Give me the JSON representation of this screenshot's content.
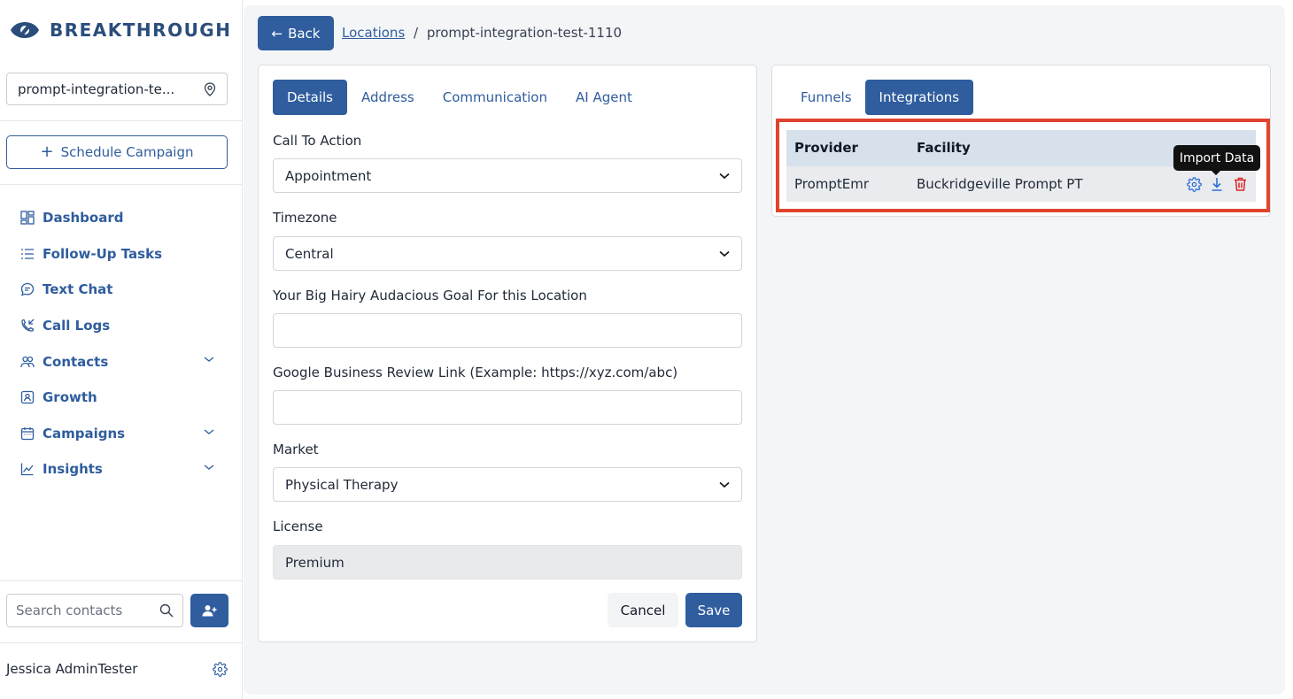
{
  "brand": {
    "name": "BREAKTHROUGH"
  },
  "sidebar": {
    "location_select": "prompt-integration-te...",
    "schedule_button": "Schedule Campaign",
    "nav": [
      {
        "label": "Dashboard",
        "icon": "dashboard-icon"
      },
      {
        "label": "Follow-Up Tasks",
        "icon": "list-icon"
      },
      {
        "label": "Text Chat",
        "icon": "chat-icon"
      },
      {
        "label": "Call Logs",
        "icon": "phone-icon"
      },
      {
        "label": "Contacts",
        "icon": "contacts-icon",
        "expandable": true
      },
      {
        "label": "Growth",
        "icon": "growth-icon"
      },
      {
        "label": "Campaigns",
        "icon": "calendar-icon",
        "expandable": true
      },
      {
        "label": "Insights",
        "icon": "chart-line-icon",
        "expandable": true
      }
    ],
    "search_placeholder": "Search contacts",
    "user_name": "Jessica AdminTester"
  },
  "header": {
    "back_label": "Back",
    "breadcrumb_link": "Locations",
    "breadcrumb_separator": "/",
    "breadcrumb_current": "prompt-integration-test-1110"
  },
  "left_card": {
    "tabs": [
      "Details",
      "Address",
      "Communication",
      "AI Agent"
    ],
    "active_tab": "Details",
    "fields": {
      "cta_label": "Call To Action",
      "cta_value": "Appointment",
      "timezone_label": "Timezone",
      "timezone_value": "Central",
      "goal_label": "Your Big Hairy Audacious Goal For this Location",
      "goal_value": "",
      "review_label": "Google Business Review Link (Example: https://xyz.com/abc)",
      "review_value": "",
      "market_label": "Market",
      "market_value": "Physical Therapy",
      "license_label": "License",
      "license_value": "Premium"
    },
    "cancel_label": "Cancel",
    "save_label": "Save"
  },
  "right_card": {
    "tabs": [
      "Funnels",
      "Integrations"
    ],
    "active_tab": "Integrations",
    "table": {
      "headers": [
        "Provider",
        "Facility"
      ],
      "rows": [
        {
          "provider": "PromptEmr",
          "facility": "Buckridgeville Prompt PT"
        }
      ]
    },
    "tooltip": "Import Data"
  },
  "colors": {
    "primary": "#2f5d9e",
    "highlight": "#e0442d",
    "danger": "#dc2626"
  }
}
